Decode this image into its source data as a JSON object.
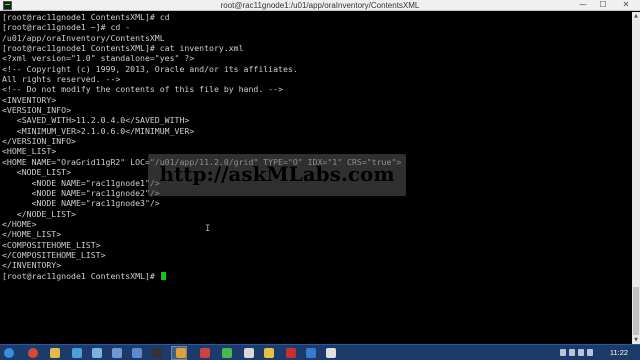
{
  "window": {
    "title": "root@rac11gnode1:/u01/app/oraInventory/ContentsXML",
    "min_glyph": "—",
    "max_glyph": "☐",
    "close_glyph": "✕"
  },
  "terminal": {
    "lines": [
      "[root@rac11gnode1 ContentsXML]# cd",
      "[root@rac11gnode1 ~]# cd -",
      "/u01/app/oraInventory/ContentsXML",
      "[root@rac11gnode1 ContentsXML]# cat inventory.xml",
      "<?xml version=\"1.0\" standalone=\"yes\" ?>",
      "<!-- Copyright (c) 1999, 2013, Oracle and/or its affiliates.",
      "All rights reserved. -->",
      "<!-- Do not modify the contents of this file by hand. -->",
      "<INVENTORY>",
      "<VERSION_INFO>",
      "   <SAVED_WITH>11.2.0.4.0</SAVED_WITH>",
      "   <MINIMUM_VER>2.1.0.6.0</MINIMUM_VER>",
      "</VERSION_INFO>",
      "<HOME_LIST>",
      "<HOME NAME=\"OraGrid11gR2\" LOC=\"/u01/app/11.2.0/grid\" TYPE=\"O\" IDX=\"1\" CRS=\"true\">",
      "   <NODE_LIST>",
      "      <NODE NAME=\"rac11gnode1\"/>",
      "      <NODE NAME=\"rac11gnode2\"/>",
      "      <NODE NAME=\"rac11gnode3\"/>",
      "   </NODE_LIST>",
      "</HOME>",
      "</HOME_LIST>",
      "<COMPOSITEHOME_LIST>",
      "</COMPOSITEHOME_LIST>",
      "</INVENTORY>",
      "[root@rac11gnode1 ContentsXML]# "
    ],
    "text_color": "#cfcfcf",
    "cursor_color": "#00d200"
  },
  "watermark": {
    "text": "http://askMLabs.com"
  },
  "taskbar": {
    "clock": "11:22",
    "icons": [
      {
        "name": "start-icon",
        "color": "#3a8de0"
      },
      {
        "name": "chrome-icon",
        "color": "#d9473b"
      },
      {
        "name": "explorer-icon",
        "color": "#e8b84a"
      },
      {
        "name": "media-icon",
        "color": "#4aa0d8"
      },
      {
        "name": "app-icon",
        "color": "#7fb0e0"
      },
      {
        "name": "app-icon",
        "color": "#6e9ad4"
      },
      {
        "name": "app-icon",
        "color": "#5d8bd0"
      },
      {
        "name": "terminal-icon",
        "color": "#333333"
      },
      {
        "name": "app-icon",
        "color": "#e0a03a"
      },
      {
        "name": "app-icon",
        "color": "#d04040"
      },
      {
        "name": "app-icon",
        "color": "#4ab84a"
      },
      {
        "name": "app-icon",
        "color": "#d8d8d8"
      },
      {
        "name": "app-icon",
        "color": "#e8c040"
      },
      {
        "name": "app-icon",
        "color": "#c83030"
      },
      {
        "name": "app-icon",
        "color": "#3a7ad0"
      },
      {
        "name": "app-icon",
        "color": "#e0e0e0"
      }
    ]
  }
}
